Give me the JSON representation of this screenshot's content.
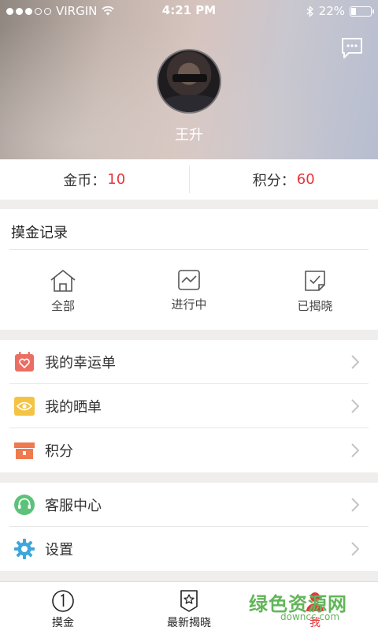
{
  "status_bar": {
    "carrier": "VIRGIN",
    "time": "4:21 PM",
    "battery": "22%"
  },
  "profile": {
    "name": "王升"
  },
  "stats": {
    "coins_label": "金币：",
    "coins_value": "10",
    "points_label": "积分：",
    "points_value": "60"
  },
  "record": {
    "title": "摸金记录",
    "items": [
      {
        "label": "全部",
        "icon": "house-icon"
      },
      {
        "label": "进行中",
        "icon": "chart-icon"
      },
      {
        "label": "已揭晓",
        "icon": "check-doc-icon"
      }
    ]
  },
  "menu_group_1": [
    {
      "label": "我的幸运单",
      "icon": "calendar-heart-icon",
      "color": "#ec6e62"
    },
    {
      "label": "我的晒单",
      "icon": "eye-icon",
      "color": "#f5c342"
    },
    {
      "label": "积分",
      "icon": "box-icon",
      "color": "#ef7a4d"
    }
  ],
  "menu_group_2": [
    {
      "label": "客服中心",
      "icon": "headset-icon",
      "color": "#5cc27a"
    },
    {
      "label": "设置",
      "icon": "gear-icon",
      "color": "#3da6dc"
    }
  ],
  "tabbar": [
    {
      "label": "摸金",
      "icon": "number-one-icon"
    },
    {
      "label": "最新揭晓",
      "icon": "star-badge-icon"
    },
    {
      "label": "我",
      "icon": "person-icon",
      "active": true
    }
  ],
  "watermark": {
    "brand": "绿色资源网",
    "site": "downcc.com"
  },
  "colors": {
    "accent": "#e5353b",
    "background": "#efeeec"
  }
}
